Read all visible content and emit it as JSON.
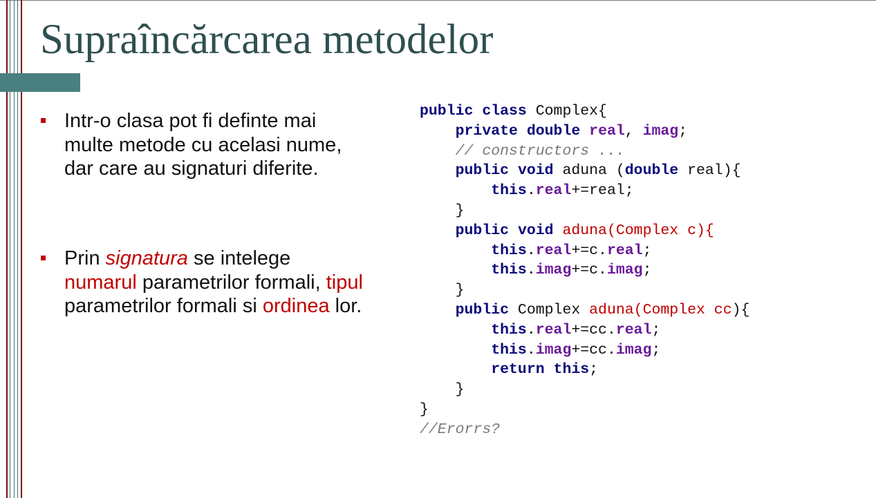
{
  "slide": {
    "title": "Supraîncărcarea metodelor",
    "bullet1": {
      "text": "Intr-o clasa pot fi definte mai multe metode cu acelasi nume, dar care au signaturi diferite."
    },
    "bullet2": {
      "part1": " Prin ",
      "signatura": "signatura",
      "part2": " se intelege ",
      "numarul": "numarul",
      "part3": " parametrilor formali, ",
      "tipul": "tipul",
      "part4": " parametrilor formali si ",
      "ordinea": "ordinea",
      "part5": " lor."
    }
  },
  "code": {
    "l1": {
      "k1": "public",
      "s1": " ",
      "k2": "class",
      "rest": " Complex{"
    },
    "l2": {
      "ind": "    ",
      "k1": "private",
      "s1": " ",
      "k2": "double",
      "s2": " ",
      "f1": "real",
      "s3": ", ",
      "f2": "imag",
      "end": ";"
    },
    "l3": {
      "ind": "    ",
      "c": "// constructors ..."
    },
    "l4": {
      "ind": "    ",
      "k1": "public",
      "s1": " ",
      "k2": "void",
      "m": " aduna (",
      "k3": "double",
      "end": " real){"
    },
    "l5": {
      "ind": "        ",
      "k1": "this",
      "dot": ".",
      "f1": "real",
      "end": "+=real;"
    },
    "l6": {
      "text": "    }"
    },
    "l7": {
      "ind": "    ",
      "k1": "public",
      "s1": " ",
      "k2": "void",
      "s2": " ",
      "r": "aduna(Complex c){"
    },
    "l8": {
      "ind": "        ",
      "k1": "this",
      "dot": ".",
      "f1": "real",
      "mid": "+=c.",
      "f2": "real",
      "end": ";"
    },
    "l9": {
      "ind": "        ",
      "k1": "this",
      "dot": ".",
      "f1": "imag",
      "mid": "+=c.",
      "f2": "imag",
      "end": ";"
    },
    "l10": {
      "text": "    }"
    },
    "l11": {
      "ind": "    ",
      "k1": "public",
      "t": " Complex ",
      "r": "aduna(Complex cc",
      "end": "){"
    },
    "l12": {
      "ind": "        ",
      "k1": "this",
      "dot": ".",
      "f1": "real",
      "mid": "+=cc.",
      "f2": "real",
      "end": ";"
    },
    "l13": {
      "ind": "        ",
      "k1": "this",
      "dot": ".",
      "f1": "imag",
      "mid": "+=cc.",
      "f2": "imag",
      "end": ";"
    },
    "l14": {
      "ind": "        ",
      "k1": "return",
      "s1": " ",
      "k2": "this",
      "end": ";"
    },
    "l15": {
      "text": "    }"
    },
    "l16": {
      "text": "}"
    },
    "l17": {
      "c": "//Erorrs?"
    }
  }
}
